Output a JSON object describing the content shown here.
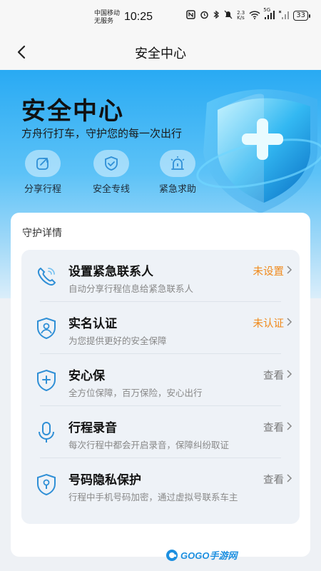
{
  "status_bar": {
    "carrier_line1": "中国移动",
    "carrier_line2": "无服务",
    "time": "10:25",
    "network_speed_top": "2.3",
    "network_speed_bottom": "K/s",
    "signal_label": "5G",
    "battery": "33"
  },
  "nav": {
    "title": "安全中心"
  },
  "hero": {
    "title": "安全中心",
    "subtitle": "方舟行打车，守护您的每一次出行",
    "quick_actions": [
      {
        "label": "分享行程",
        "icon": "share-icon"
      },
      {
        "label": "安全专线",
        "icon": "shield-check-icon"
      },
      {
        "label": "紧急求助",
        "icon": "alarm-icon"
      }
    ]
  },
  "guard": {
    "section_title": "守护详情",
    "items": [
      {
        "name": "设置紧急联系人",
        "desc": "自动分享行程信息给紧急联系人",
        "status": "未设置",
        "status_color": "#f08a1c",
        "icon": "phone-icon"
      },
      {
        "name": "实名认证",
        "desc": "为您提供更好的安全保障",
        "status": "未认证",
        "status_color": "#f08a1c",
        "icon": "id-shield-icon"
      },
      {
        "name": "安心保",
        "desc": "全方位保障，百万保险，安心出行",
        "status": "查看",
        "status_color": "#777777",
        "icon": "plus-shield-icon"
      },
      {
        "name": "行程录音",
        "desc": "每次行程中都会开启录音，保障纠纷取证",
        "status": "查看",
        "status_color": "#777777",
        "icon": "microphone-icon"
      },
      {
        "name": "号码隐私保护",
        "desc": "行程中手机号码加密，通过虚拟号联系车主",
        "status": "查看",
        "status_color": "#777777",
        "icon": "lock-shield-icon"
      }
    ]
  },
  "watermark": {
    "text": "GOGO手游网"
  },
  "colors": {
    "accent_blue": "#2f8fd6",
    "warning_orange": "#f08a1c",
    "hero_top": "#29aaf3"
  }
}
